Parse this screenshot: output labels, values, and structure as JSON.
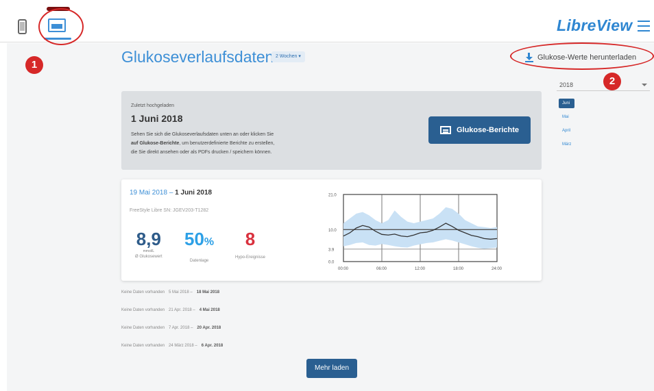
{
  "header": {
    "logo": "LibreView"
  },
  "page": {
    "title": "Glukoseverlaufsdaten",
    "range_select": "2 Wochen",
    "download_label": "Glukose-Werte herunterladen"
  },
  "picker": {
    "year": "2018",
    "months": [
      "Juni",
      "Mai",
      "April",
      "März"
    ]
  },
  "upload": {
    "label": "Zuletzt hochgeladen",
    "date": "1 Juni 2018",
    "desc_1": "Sehen Sie sich die Glukoseverlaufsdaten unten an oder klicken Sie",
    "desc_2_bold": "auf Glukose-Berichte",
    "desc_2_rest": ", um benutzerdefinierte Berichte zu erstellen,",
    "desc_3": "die Sie direkt ansehen oder als PDFs drucken / speichern können.",
    "button": "Glukose-Berichte"
  },
  "summary": {
    "range_start": "19 Mai 2018",
    "range_sep": " – ",
    "range_end": "1 Juni 2018",
    "device": "FreeStyle Libre  SN: JGEV203-T1282",
    "avg_value": "8,9",
    "avg_unit": "mmol/L",
    "avg_label": "Ø Glukosewert",
    "data_value": "50",
    "data_pct": "%",
    "data_label": "Datenlage",
    "hypo_value": "8",
    "hypo_label": "Hypo-Ereignisse"
  },
  "chart_data": {
    "type": "area",
    "y_ticks": [
      "21.0",
      "10.0",
      "3.9",
      "0.0"
    ],
    "x_ticks": [
      "00:00",
      "06:00",
      "12:00",
      "18:00",
      "24:00"
    ],
    "ylim": [
      0,
      21
    ],
    "target_line": 10.0,
    "low_line": 3.9,
    "x": [
      0,
      1,
      2,
      3,
      4,
      5,
      6,
      7,
      8,
      9,
      10,
      11,
      12,
      13,
      14,
      15,
      16,
      17,
      18,
      19,
      20,
      21,
      22,
      23,
      24
    ],
    "median": [
      8.0,
      9.0,
      10.5,
      11.3,
      10.8,
      9.5,
      8.5,
      8.3,
      8.6,
      8.0,
      7.8,
      8.3,
      9.0,
      9.2,
      9.8,
      10.8,
      12.0,
      11.0,
      9.8,
      9.0,
      8.2,
      7.8,
      7.2,
      7.0,
      7.2
    ],
    "band_low": [
      4.8,
      5.2,
      5.8,
      6.0,
      5.2,
      5.0,
      5.5,
      5.2,
      4.8,
      4.5,
      4.4,
      5.0,
      5.4,
      5.8,
      6.0,
      6.5,
      7.0,
      6.6,
      6.0,
      5.4,
      4.8,
      4.3,
      4.0,
      4.2,
      4.4
    ],
    "band_high": [
      12.0,
      13.5,
      15.0,
      15.5,
      14.5,
      13.0,
      12.0,
      13.0,
      16.0,
      14.0,
      12.5,
      12.0,
      12.5,
      13.0,
      13.5,
      15.0,
      17.0,
      16.5,
      15.0,
      13.0,
      12.0,
      11.0,
      10.8,
      10.5,
      10.8
    ]
  },
  "history": [
    {
      "text": "Keine Daten vorhanden",
      "range": "5 Mai 2018 –",
      "end": "18 Mai 2018"
    },
    {
      "text": "Keine Daten vorhanden",
      "range": "21 Apr. 2018 –",
      "end": "4 Mai 2018"
    },
    {
      "text": "Keine Daten vorhanden",
      "range": "7 Apr. 2018 –",
      "end": "20 Apr. 2018"
    },
    {
      "text": "Keine Daten vorhanden",
      "range": "24 März 2018 –",
      "end": "6 Apr. 2018"
    }
  ],
  "more_button": "Mehr laden",
  "annotations": {
    "badge_1": "1",
    "badge_2": "2"
  },
  "colors": {
    "brand": "#2e86d1",
    "button": "#2a5f91",
    "annotation": "#d62828",
    "hypo": "#d9313e",
    "data_pct": "#2da0e6"
  }
}
